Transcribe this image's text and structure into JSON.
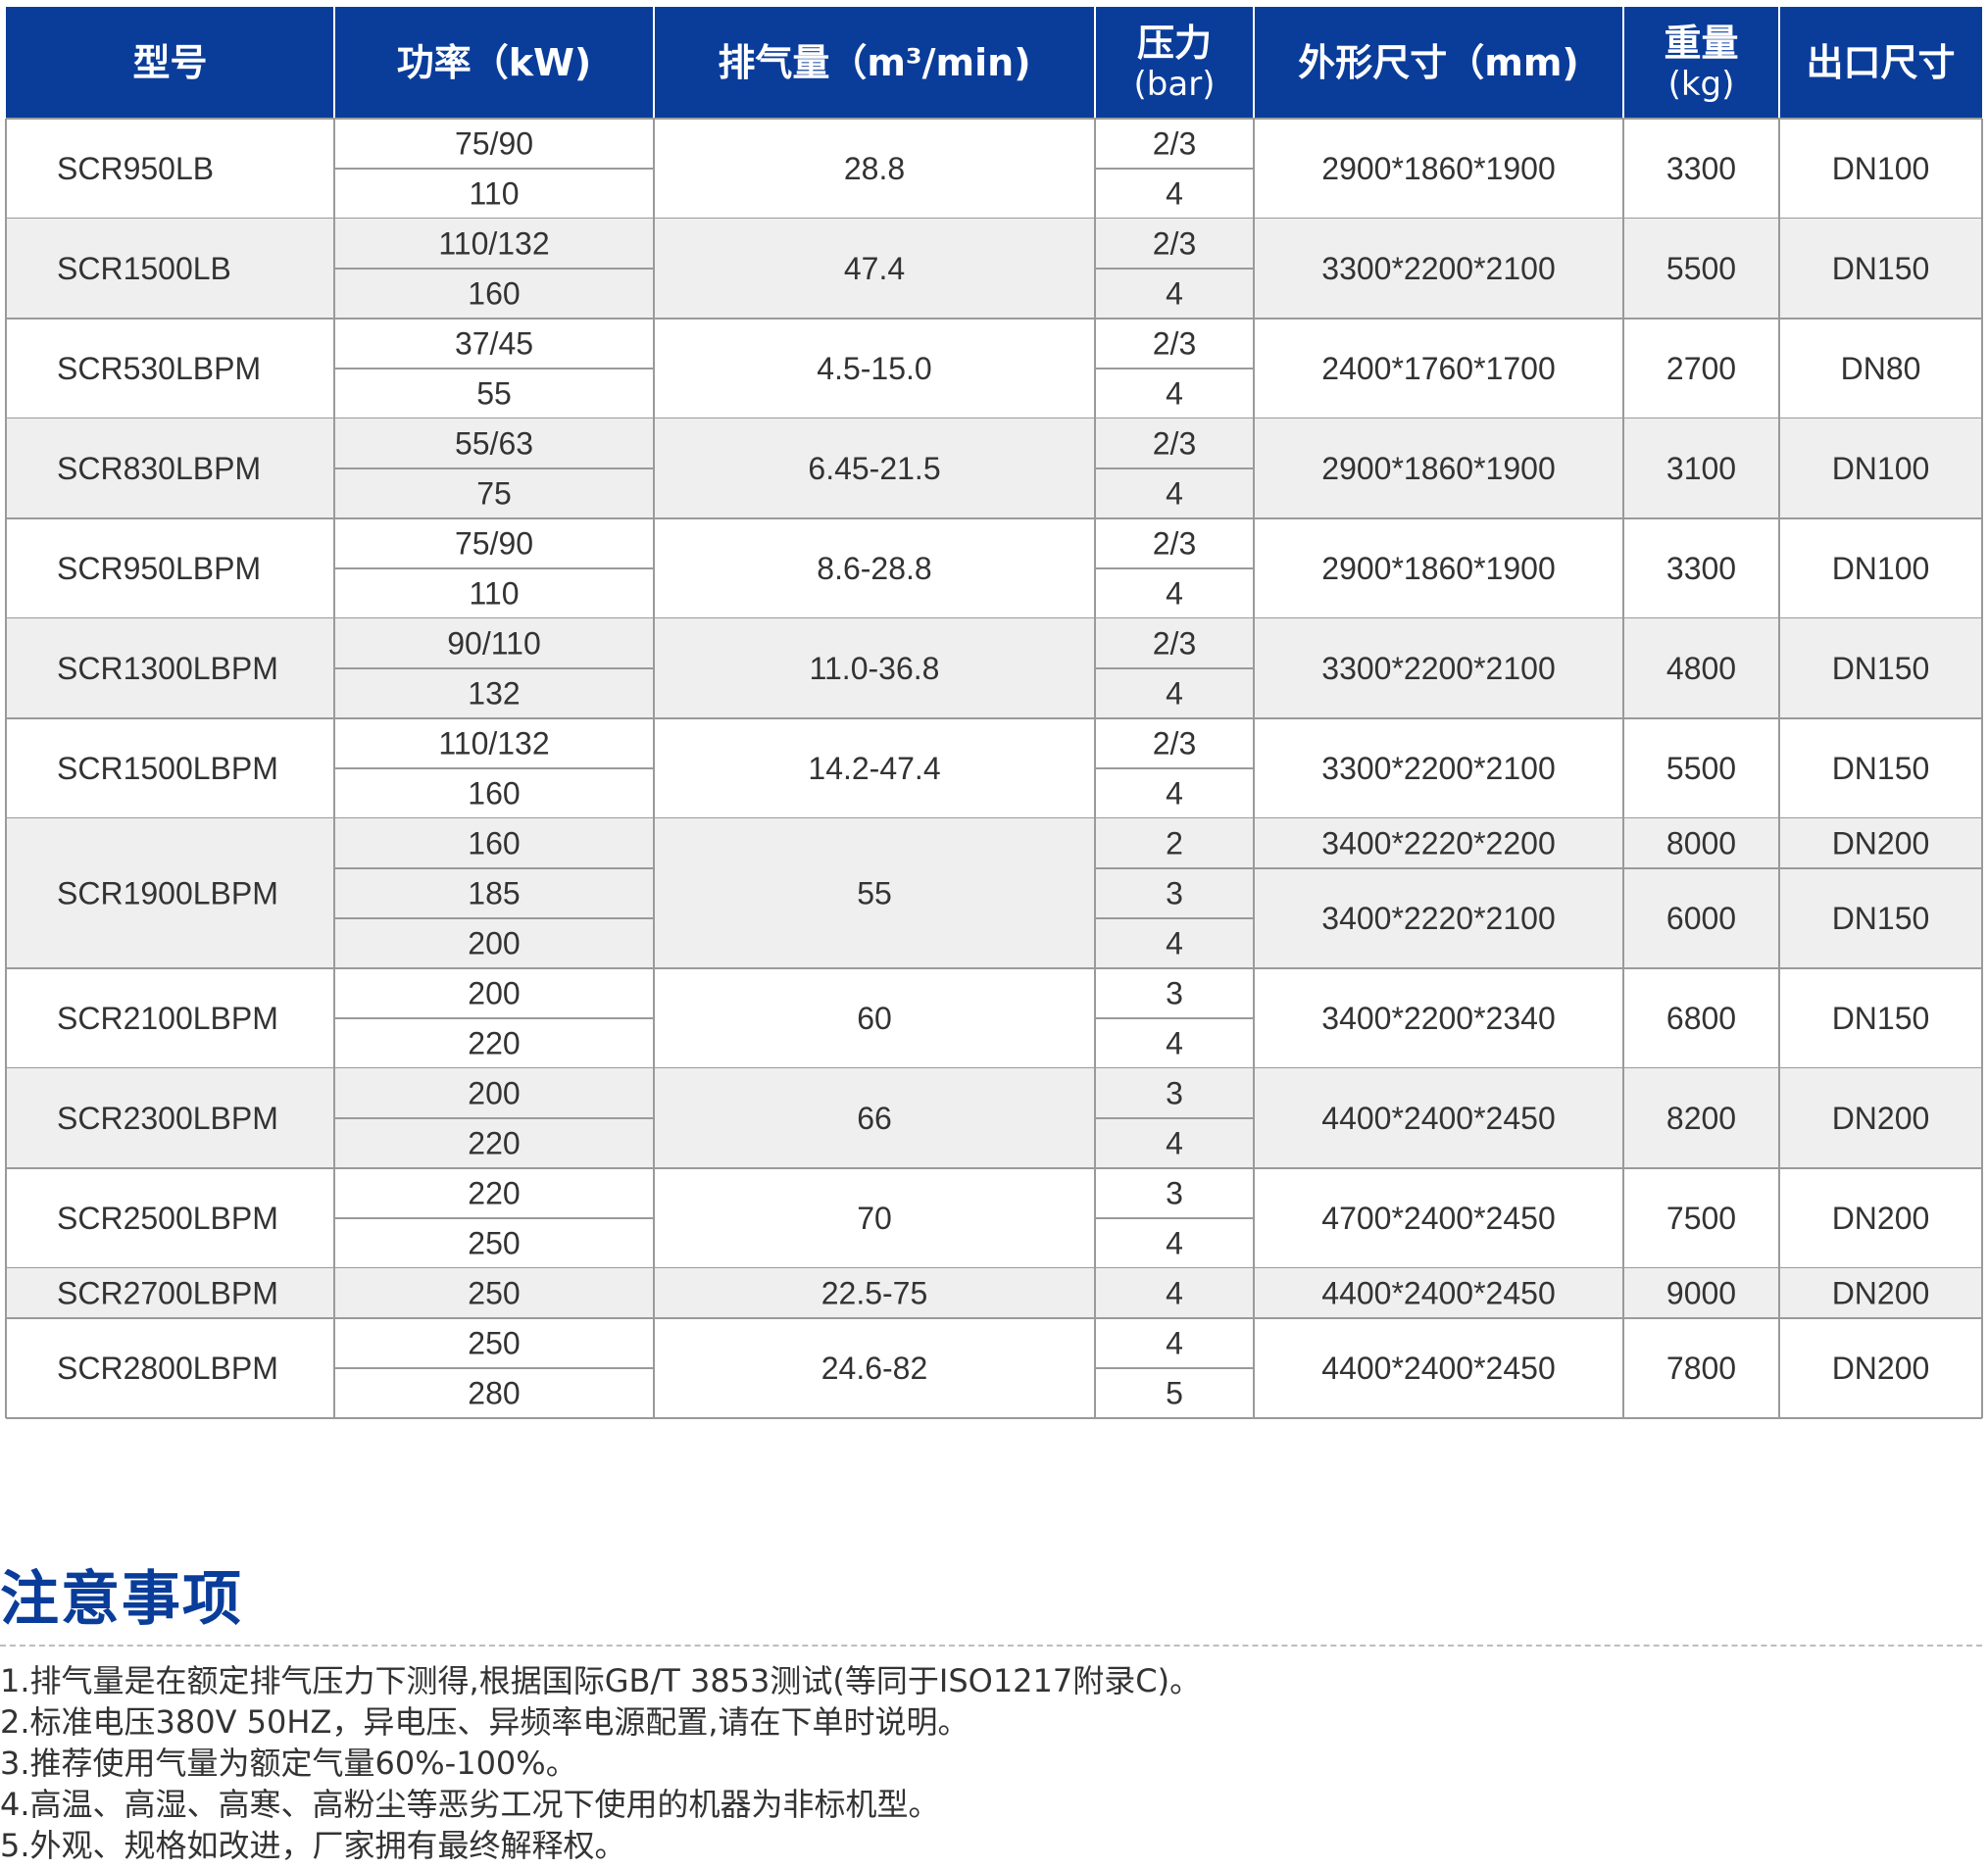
{
  "table": {
    "headers": [
      {
        "lines": [
          "型号"
        ]
      },
      {
        "lines": [
          "功率（kW)"
        ]
      },
      {
        "lines": [
          "排气量（m³/min)"
        ]
      },
      {
        "lines": [
          "压力",
          "(bar)"
        ]
      },
      {
        "lines": [
          "外形尺寸（mm)"
        ]
      },
      {
        "lines": [
          "重量",
          "(kg)"
        ]
      },
      {
        "lines": [
          "出口尺寸"
        ]
      }
    ],
    "rows": [
      {
        "model": "SCR950LB",
        "power": [
          "75/90",
          "110"
        ],
        "flow": "28.8",
        "pressure": [
          "2/3",
          "4"
        ],
        "dims": [
          "2900*1860*1900"
        ],
        "weight": [
          "3300"
        ],
        "outlet": [
          "DN100"
        ]
      },
      {
        "model": "SCR1500LB",
        "power": [
          "110/132",
          "160"
        ],
        "flow": "47.4",
        "pressure": [
          "2/3",
          "4"
        ],
        "dims": [
          "3300*2200*2100"
        ],
        "weight": [
          "5500"
        ],
        "outlet": [
          "DN150"
        ]
      },
      {
        "model": "SCR530LBPM",
        "power": [
          "37/45",
          "55"
        ],
        "flow": "4.5-15.0",
        "pressure": [
          "2/3",
          "4"
        ],
        "dims": [
          "2400*1760*1700"
        ],
        "weight": [
          "2700"
        ],
        "outlet": [
          "DN80"
        ]
      },
      {
        "model": "SCR830LBPM",
        "power": [
          "55/63",
          "75"
        ],
        "flow": "6.45-21.5",
        "pressure": [
          "2/3",
          "4"
        ],
        "dims": [
          "2900*1860*1900"
        ],
        "weight": [
          "3100"
        ],
        "outlet": [
          "DN100"
        ]
      },
      {
        "model": "SCR950LBPM",
        "power": [
          "75/90",
          "110"
        ],
        "flow": "8.6-28.8",
        "pressure": [
          "2/3",
          "4"
        ],
        "dims": [
          "2900*1860*1900"
        ],
        "weight": [
          "3300"
        ],
        "outlet": [
          "DN100"
        ]
      },
      {
        "model": "SCR1300LBPM",
        "power": [
          "90/110",
          "132"
        ],
        "flow": "11.0-36.8",
        "pressure": [
          "2/3",
          "4"
        ],
        "dims": [
          "3300*2200*2100"
        ],
        "weight": [
          "4800"
        ],
        "outlet": [
          "DN150"
        ]
      },
      {
        "model": "SCR1500LBPM",
        "power": [
          "110/132",
          "160"
        ],
        "flow": "14.2-47.4",
        "pressure": [
          "2/3",
          "4"
        ],
        "dims": [
          "3300*2200*2100"
        ],
        "weight": [
          "5500"
        ],
        "outlet": [
          "DN150"
        ]
      },
      {
        "model": "SCR1900LBPM",
        "power": [
          "160",
          "185",
          "200"
        ],
        "flow": "55",
        "pressure": [
          "2",
          "3",
          "4"
        ],
        "dims": [
          "3400*2220*2200",
          "3400*2220*2100"
        ],
        "weight": [
          "8000",
          "6000"
        ],
        "outlet": [
          "DN200",
          "DN150"
        ]
      },
      {
        "model": "SCR2100LBPM",
        "power": [
          "200",
          "220"
        ],
        "flow": "60",
        "pressure": [
          "3",
          "4"
        ],
        "dims": [
          "3400*2200*2340"
        ],
        "weight": [
          "6800"
        ],
        "outlet": [
          "DN150"
        ]
      },
      {
        "model": "SCR2300LBPM",
        "power": [
          "200",
          "220"
        ],
        "flow": "66",
        "pressure": [
          "3",
          "4"
        ],
        "dims": [
          "4400*2400*2450"
        ],
        "weight": [
          "8200"
        ],
        "outlet": [
          "DN200"
        ]
      },
      {
        "model": "SCR2500LBPM",
        "power": [
          "220",
          "250"
        ],
        "flow": "70",
        "pressure": [
          "3",
          "4"
        ],
        "dims": [
          "4700*2400*2450"
        ],
        "weight": [
          "7500"
        ],
        "outlet": [
          "DN200"
        ]
      },
      {
        "model": "SCR2700LBPM",
        "power": [
          "250"
        ],
        "flow": "22.5-75",
        "pressure": [
          "4"
        ],
        "dims": [
          "4400*2400*2450"
        ],
        "weight": [
          "9000"
        ],
        "outlet": [
          "DN200"
        ]
      },
      {
        "model": "SCR2800LBPM",
        "power": [
          "250",
          "280"
        ],
        "flow": "24.6-82",
        "pressure": [
          "4",
          "5"
        ],
        "dims": [
          "4400*2400*2450"
        ],
        "weight": [
          "7800"
        ],
        "outlet": [
          "DN200"
        ]
      }
    ]
  },
  "notes": {
    "title": "注意事项",
    "items": [
      "1.排气量是在额定排气压力下测得,根据国际GB/T 3853测试(等同于ISO1217附录C)。",
      "2.标准电压380V 50HZ，异电压、异频率电源配置,请在下单时说明。",
      "3.推荐使用气量为额定气量60%-100%。",
      "4.高温、高湿、高寒、高粉尘等恶劣工况下使用的机器为非标机型。",
      "5.外观、规格如改进，厂家拥有最终解释权。"
    ]
  },
  "colors": {
    "header_bg": "#0a3d9a",
    "header_text": "#ffffff",
    "stripe_bg": "#efefef",
    "grid_line": "#9a9a9a",
    "title_color": "#0a3d9a",
    "body_text": "#333333"
  }
}
